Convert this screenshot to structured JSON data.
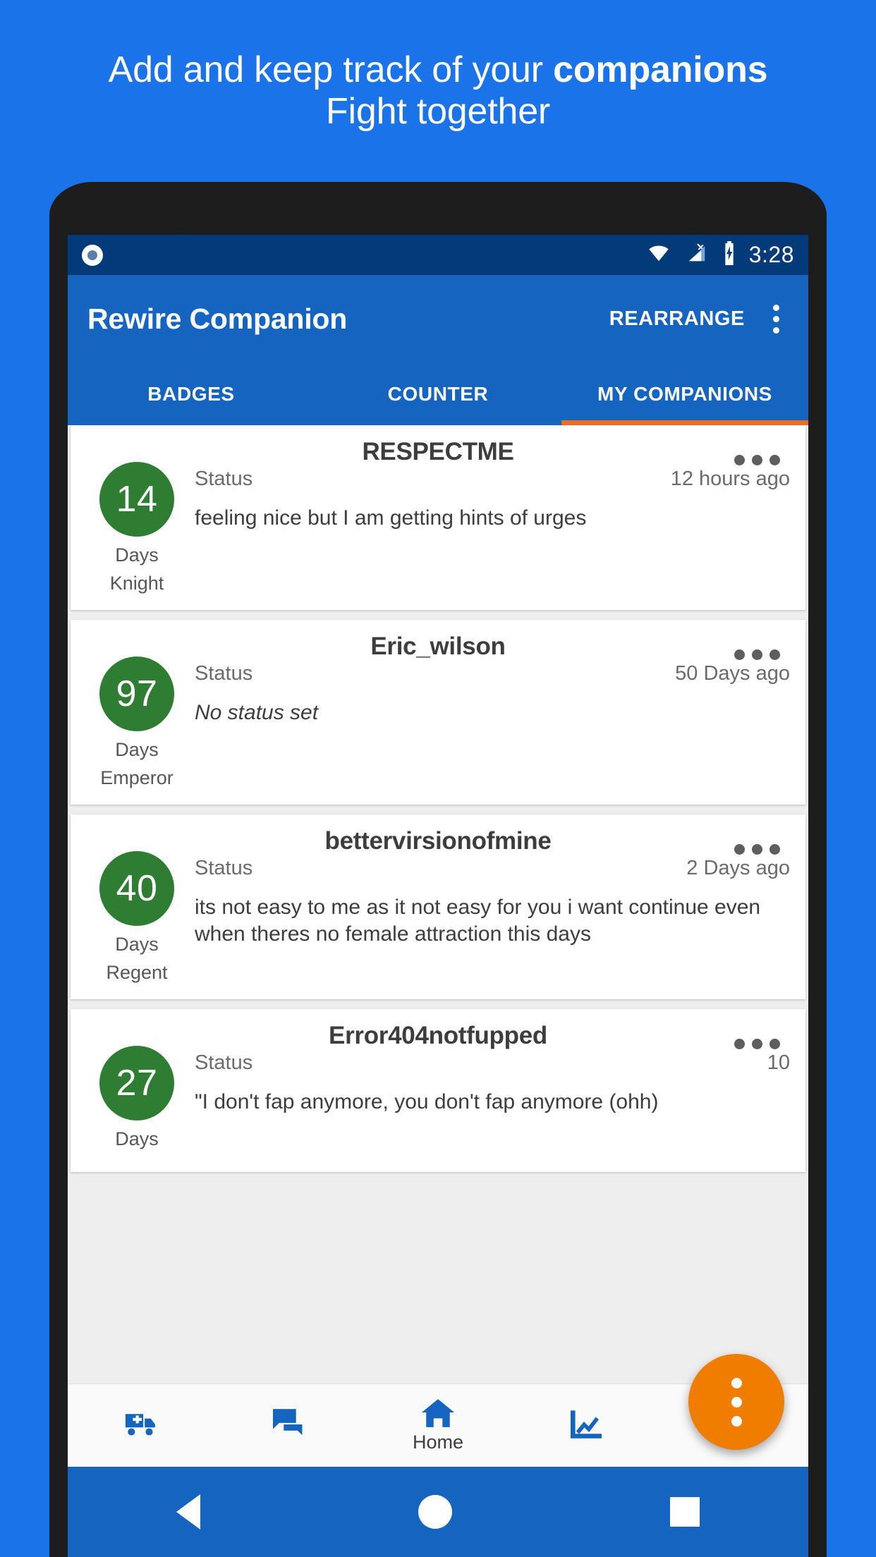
{
  "promo": {
    "line1_prefix": "Add and keep track of your ",
    "line1_strong": "companions",
    "line2": "Fight together"
  },
  "statusbar": {
    "indicator_icon": "record-circle-icon",
    "wifi_icon": "wifi-icon",
    "signal_icon": "no-sim-signal-icon",
    "battery_icon": "battery-charging-icon",
    "time": "3:28"
  },
  "appbar": {
    "title": "Rewire Companion",
    "action_label": "REARRANGE",
    "overflow_icon": "overflow-menu-icon"
  },
  "tabs": [
    {
      "label": "BADGES",
      "active": false
    },
    {
      "label": "COUNTER",
      "active": false
    },
    {
      "label": "MY COMPANIONS",
      "active": true
    }
  ],
  "companions": [
    {
      "name": "RESPECTME",
      "days": "14",
      "days_label": "Days",
      "rank": "Knight",
      "status_label": "Status",
      "time_ago": "12 hours ago",
      "status_text": "feeling nice but I am getting hints of urges",
      "status_empty": false
    },
    {
      "name": "Eric_wilson",
      "days": "97",
      "days_label": "Days",
      "rank": "Emperor",
      "status_label": "Status",
      "time_ago": "50 Days ago",
      "status_text": "No status set",
      "status_empty": true
    },
    {
      "name": "bettervirsionofmine",
      "days": "40",
      "days_label": "Days",
      "rank": "Regent",
      "status_label": "Status",
      "time_ago": "2 Days ago",
      "status_text": "its not easy to me as it not easy for you i want  continue even when theres no female attraction this days",
      "status_empty": false
    },
    {
      "name": "Error404notfupped",
      "days": "27",
      "days_label": "Days",
      "rank": "",
      "status_label": "Status",
      "time_ago": "10",
      "status_text": "\"I don't fap anymore, you don't fap anymore (ohh)",
      "status_empty": false
    }
  ],
  "fab": {
    "icon": "overflow-menu-icon"
  },
  "bottomnav": [
    {
      "icon": "ambulance-icon",
      "label": ""
    },
    {
      "icon": "chat-bubbles-icon",
      "label": ""
    },
    {
      "icon": "home-icon",
      "label": "Home"
    },
    {
      "icon": "chart-line-icon",
      "label": ""
    },
    {
      "icon": "person-icon",
      "label": ""
    }
  ],
  "sysnav": {
    "back_icon": "back-triangle-icon",
    "home_icon": "home-circle-icon",
    "recents_icon": "recents-square-icon"
  },
  "colors": {
    "background": "#1a73e8",
    "appbar": "#1565c0",
    "statusbar": "#023a7a",
    "accent": "#f06c1e",
    "fab": "#ee7d00",
    "avatar": "#2e7d32"
  }
}
